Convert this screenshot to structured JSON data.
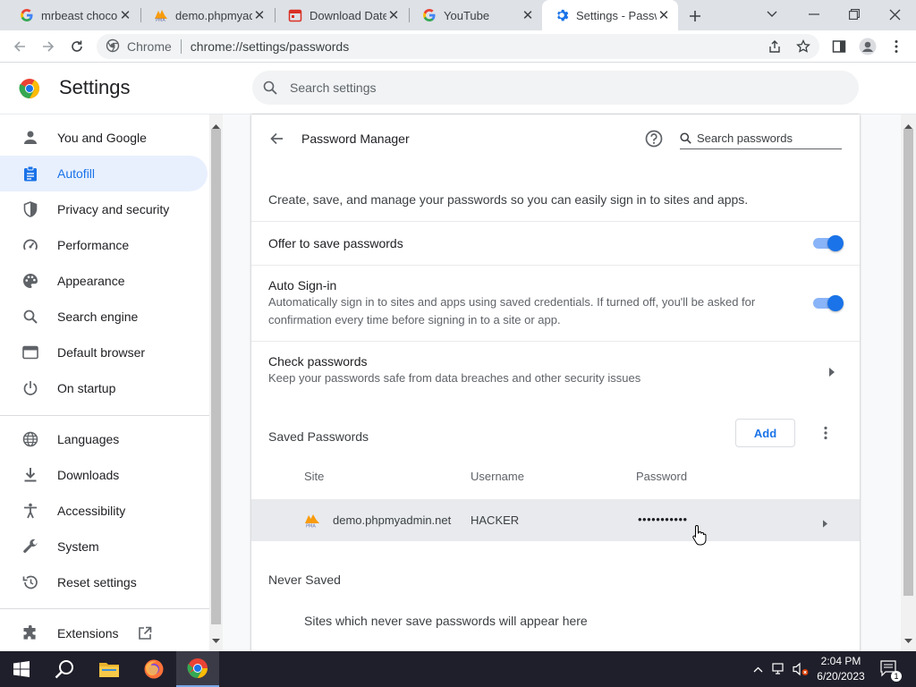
{
  "tabs": [
    {
      "title": "mrbeast chocolate",
      "favicon": "google-g-icon"
    },
    {
      "title": "demo.phpmyadmin.net",
      "favicon": "phpmyadmin-icon"
    },
    {
      "title": "Download Date",
      "favicon": "calendar-icon"
    },
    {
      "title": "YouTube",
      "favicon": "google-g-icon"
    },
    {
      "title": "Settings - Passwords",
      "favicon": "gear-icon"
    }
  ],
  "address_bar": {
    "site_label": "Chrome",
    "url": "chrome://settings/passwords"
  },
  "settings": {
    "title": "Settings",
    "search_placeholder": "Search settings"
  },
  "sidebar": {
    "items": [
      {
        "label": "You and Google",
        "icon": "person-icon"
      },
      {
        "label": "Autofill",
        "icon": "clipboard-icon",
        "selected": true
      },
      {
        "label": "Privacy and security",
        "icon": "shield-icon"
      },
      {
        "label": "Performance",
        "icon": "gauge-icon"
      },
      {
        "label": "Appearance",
        "icon": "palette-icon"
      },
      {
        "label": "Search engine",
        "icon": "search-icon"
      },
      {
        "label": "Default browser",
        "icon": "browser-icon"
      },
      {
        "label": "On startup",
        "icon": "power-icon"
      },
      {
        "label": "Languages",
        "icon": "globe-icon"
      },
      {
        "label": "Downloads",
        "icon": "download-icon"
      },
      {
        "label": "Accessibility",
        "icon": "accessibility-icon"
      },
      {
        "label": "System",
        "icon": "wrench-icon"
      },
      {
        "label": "Reset settings",
        "icon": "restore-icon"
      },
      {
        "label": "Extensions",
        "icon": "puzzle-icon"
      }
    ]
  },
  "password_manager": {
    "title": "Password Manager",
    "search_placeholder": "Search passwords",
    "description": "Create, save, and manage your passwords so you can easily sign in to sites and apps.",
    "offer_to_save": {
      "label": "Offer to save passwords",
      "enabled": true
    },
    "auto_signin": {
      "label": "Auto Sign-in",
      "description_line1": "Automatically sign in to sites and apps using saved credentials. If turned off, you'll be asked for",
      "description_line2": "confirmation every time before signing in to a site or app.",
      "enabled": true
    },
    "check_passwords": {
      "label": "Check passwords",
      "description": "Keep your passwords safe from data breaches and other security issues"
    },
    "saved_passwords": {
      "heading": "Saved Passwords",
      "add_label": "Add",
      "columns": {
        "site": "Site",
        "username": "Username",
        "password": "Password"
      },
      "rows": [
        {
          "site": "demo.phpmyadmin.net",
          "username": "HACKER",
          "password": "•••••••••••"
        }
      ]
    },
    "never_saved": {
      "heading": "Never Saved",
      "empty_text": "Sites which never save passwords will appear here"
    }
  },
  "taskbar": {
    "time": "2:04 PM",
    "date": "6/20/2023",
    "notifications": "1"
  },
  "colors": {
    "accent": "#1a73e8",
    "selected_bg": "#e8f0fe",
    "toggle_track": "#8ab4f8"
  }
}
